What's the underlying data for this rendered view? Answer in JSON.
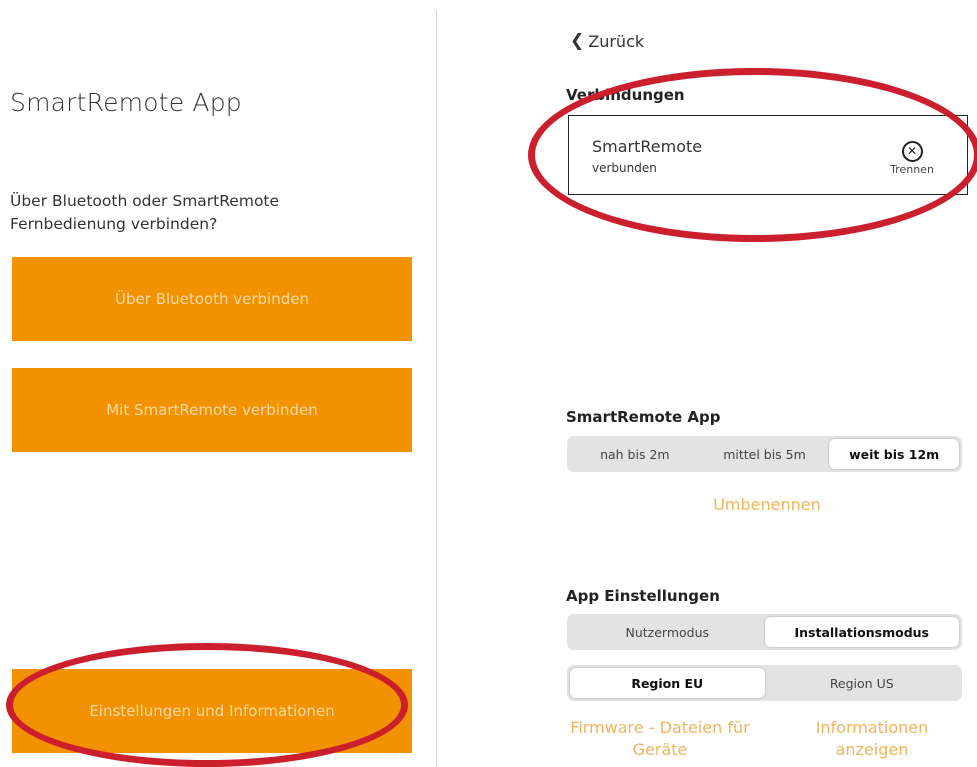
{
  "left": {
    "title": "SmartRemote App",
    "question": "Über Bluetooth oder SmartRemote Fernbedienung verbinden?",
    "btn_bluetooth": "Über Bluetooth verbinden",
    "btn_smartremote": "Mit SmartRemote verbinden",
    "btn_settings": "Einstellungen und Informationen"
  },
  "right": {
    "back_label": "Zurück",
    "connections_title": "Verbindungen",
    "connection": {
      "name": "SmartRemote",
      "status": "verbunden",
      "disconnect_label": "Trennen"
    },
    "app_section_title": "SmartRemote App",
    "range_options": [
      "nah bis 2m",
      "mittel bis 5m",
      "weit bis 12m"
    ],
    "range_selected": "weit bis 12m",
    "rename_label": "Umbenennen",
    "settings_title": "App Einstellungen",
    "mode_options": [
      "Nutzermodus",
      "Installationsmodus"
    ],
    "mode_selected": "Installationsmodus",
    "region_options": [
      "Region EU",
      "Region US"
    ],
    "region_selected": "Region EU",
    "firmware_link": "Firmware - Dateien für Geräte",
    "info_link": "Informationen anzeigen"
  },
  "colors": {
    "orange": "#f39200",
    "orange_text": "#fbd9a6",
    "link_orange": "#f3b35c",
    "annotation_red": "#cc1f2d",
    "segment_bg": "#e3e3e3"
  },
  "icons": {
    "back": "chevron-left-icon",
    "disconnect": "close-circle-icon"
  }
}
